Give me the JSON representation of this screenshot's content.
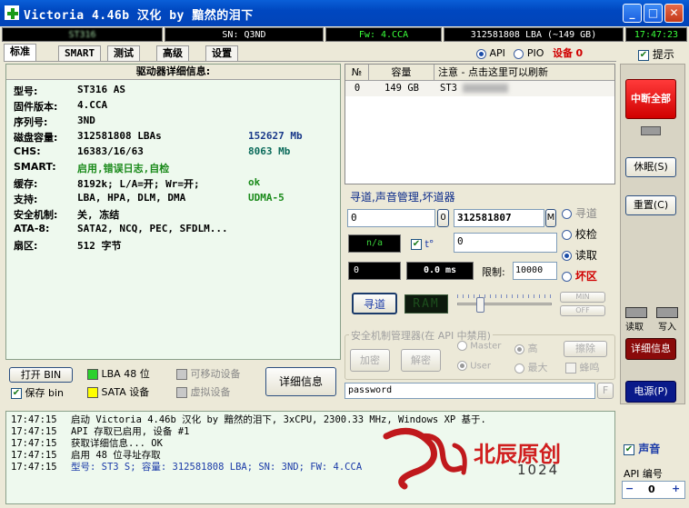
{
  "window": {
    "title": "Victoria 4.46b 汉化 by 黯然的泪下",
    "minimize": "_",
    "maximize": "□",
    "close": "✕"
  },
  "status": {
    "model": "ST316",
    "serial": "SN:      Q3ND",
    "firmware": "Fw: 4.CCA",
    "lba": "312581808 LBA (~149 GB)",
    "time": "17:47:23"
  },
  "tabs": [
    "标准",
    "SMART",
    "测试",
    "高级",
    "设置"
  ],
  "mode": {
    "api": "API",
    "pio": "PIO",
    "device_label": "设备",
    "device_num": "0",
    "hint": "提示"
  },
  "info": {
    "header": "驱动器详细信息:",
    "rows": [
      {
        "label": "型号:",
        "value": "ST316      AS",
        "value2": ""
      },
      {
        "label": "固件版本:",
        "value": "4.CCA",
        "value2": ""
      },
      {
        "label": "序列号:",
        "value": "      3ND",
        "value2": ""
      },
      {
        "label": "磁盘容量:",
        "value": "312581808 LBAs",
        "value2": "152627 Mb"
      },
      {
        "label": "CHS:",
        "value": "16383/16/63",
        "value2": "8063 Mb"
      },
      {
        "label": "SMART:",
        "value": "启用,错误日志,自检",
        "value2": ""
      },
      {
        "label": "缓存:",
        "value": "8192k; L/A=开; Wr=开;",
        "value2": "ok"
      },
      {
        "label": "支持:",
        "value": "LBA, HPA, DLM, DMA",
        "value2": "UDMA-5"
      },
      {
        "label": "安全机制:",
        "value": "关, 冻结",
        "value2": ""
      },
      {
        "label": "ATA-8:",
        "value": "SATA2, NCQ, PEC, SFDLM...",
        "value2": ""
      },
      {
        "label": "扇区:",
        "value": "512 字节",
        "value2": ""
      }
    ]
  },
  "bottom_left": {
    "open_bin": "打开 BIN",
    "save_bin": "保存 bin",
    "lba48": "LBA 48 位",
    "sata": "SATA 设备",
    "removable": "可移动设备",
    "virtual": "虚拟设备",
    "details": "详细信息"
  },
  "drive_table": {
    "col_no": "№",
    "col_cap": "容量",
    "col_note": "注意 - 点击这里可以刷新",
    "rows": [
      {
        "no": "0",
        "cap": "149 GB",
        "note": "ST3"
      }
    ]
  },
  "seek": {
    "title": "寻道,声音管理,坏道器",
    "start": "0",
    "start_btn": "0",
    "end": "312581807",
    "end_btn": "M",
    "na": "n/a",
    "t_label": "t°",
    "temp_val": "0",
    "lcd1": "0",
    "lcd2": "0.0 ms",
    "limit_label": "限制:",
    "limit_val": "10000",
    "radios": [
      "寻道",
      "校检",
      "读取",
      "坏区"
    ],
    "seek_btn": "寻道",
    "ram": "RAM",
    "min": "MIN",
    "off": "OFF"
  },
  "security": {
    "title": "安全机制管理器(在 API 中禁用)",
    "encrypt": "加密",
    "decrypt": "解密",
    "master": "Master",
    "user": "User",
    "high": "高",
    "max": "最大",
    "erase": "擦除",
    "beep": "蜂鸣",
    "password_value": "password",
    "f": "F"
  },
  "side": {
    "break_all": "中断全部",
    "sleep": "休眠(S)",
    "reset": "重置(C)",
    "read": "读取",
    "write": "写入",
    "details": "详细信息",
    "power": "电源(P)",
    "sound": "声音",
    "api_num_label": "API 编号",
    "api_num": "0",
    "minus": "−",
    "plus": "+"
  },
  "log": [
    {
      "t": "17:47:15",
      "m": "启动 Victoria 4.46b 汉化 by 黯然的泪下, 3xCPU, 2300.33 MHz, Windows XP 基于."
    },
    {
      "t": "17:47:15",
      "m": "API 存取已启用, 设备 #1"
    },
    {
      "t": "17:47:15",
      "m": "获取详细信息...  OK"
    },
    {
      "t": "17:47:15",
      "m": "启用 48 位寻址存取"
    },
    {
      "t": "17:47:15",
      "m": "型号:  ST3        S;    容量: 312581808 LBA; SN:       3ND; FW: 4.CCA"
    }
  ],
  "watermark": {
    "text": "北辰原创",
    "num": "1024"
  }
}
